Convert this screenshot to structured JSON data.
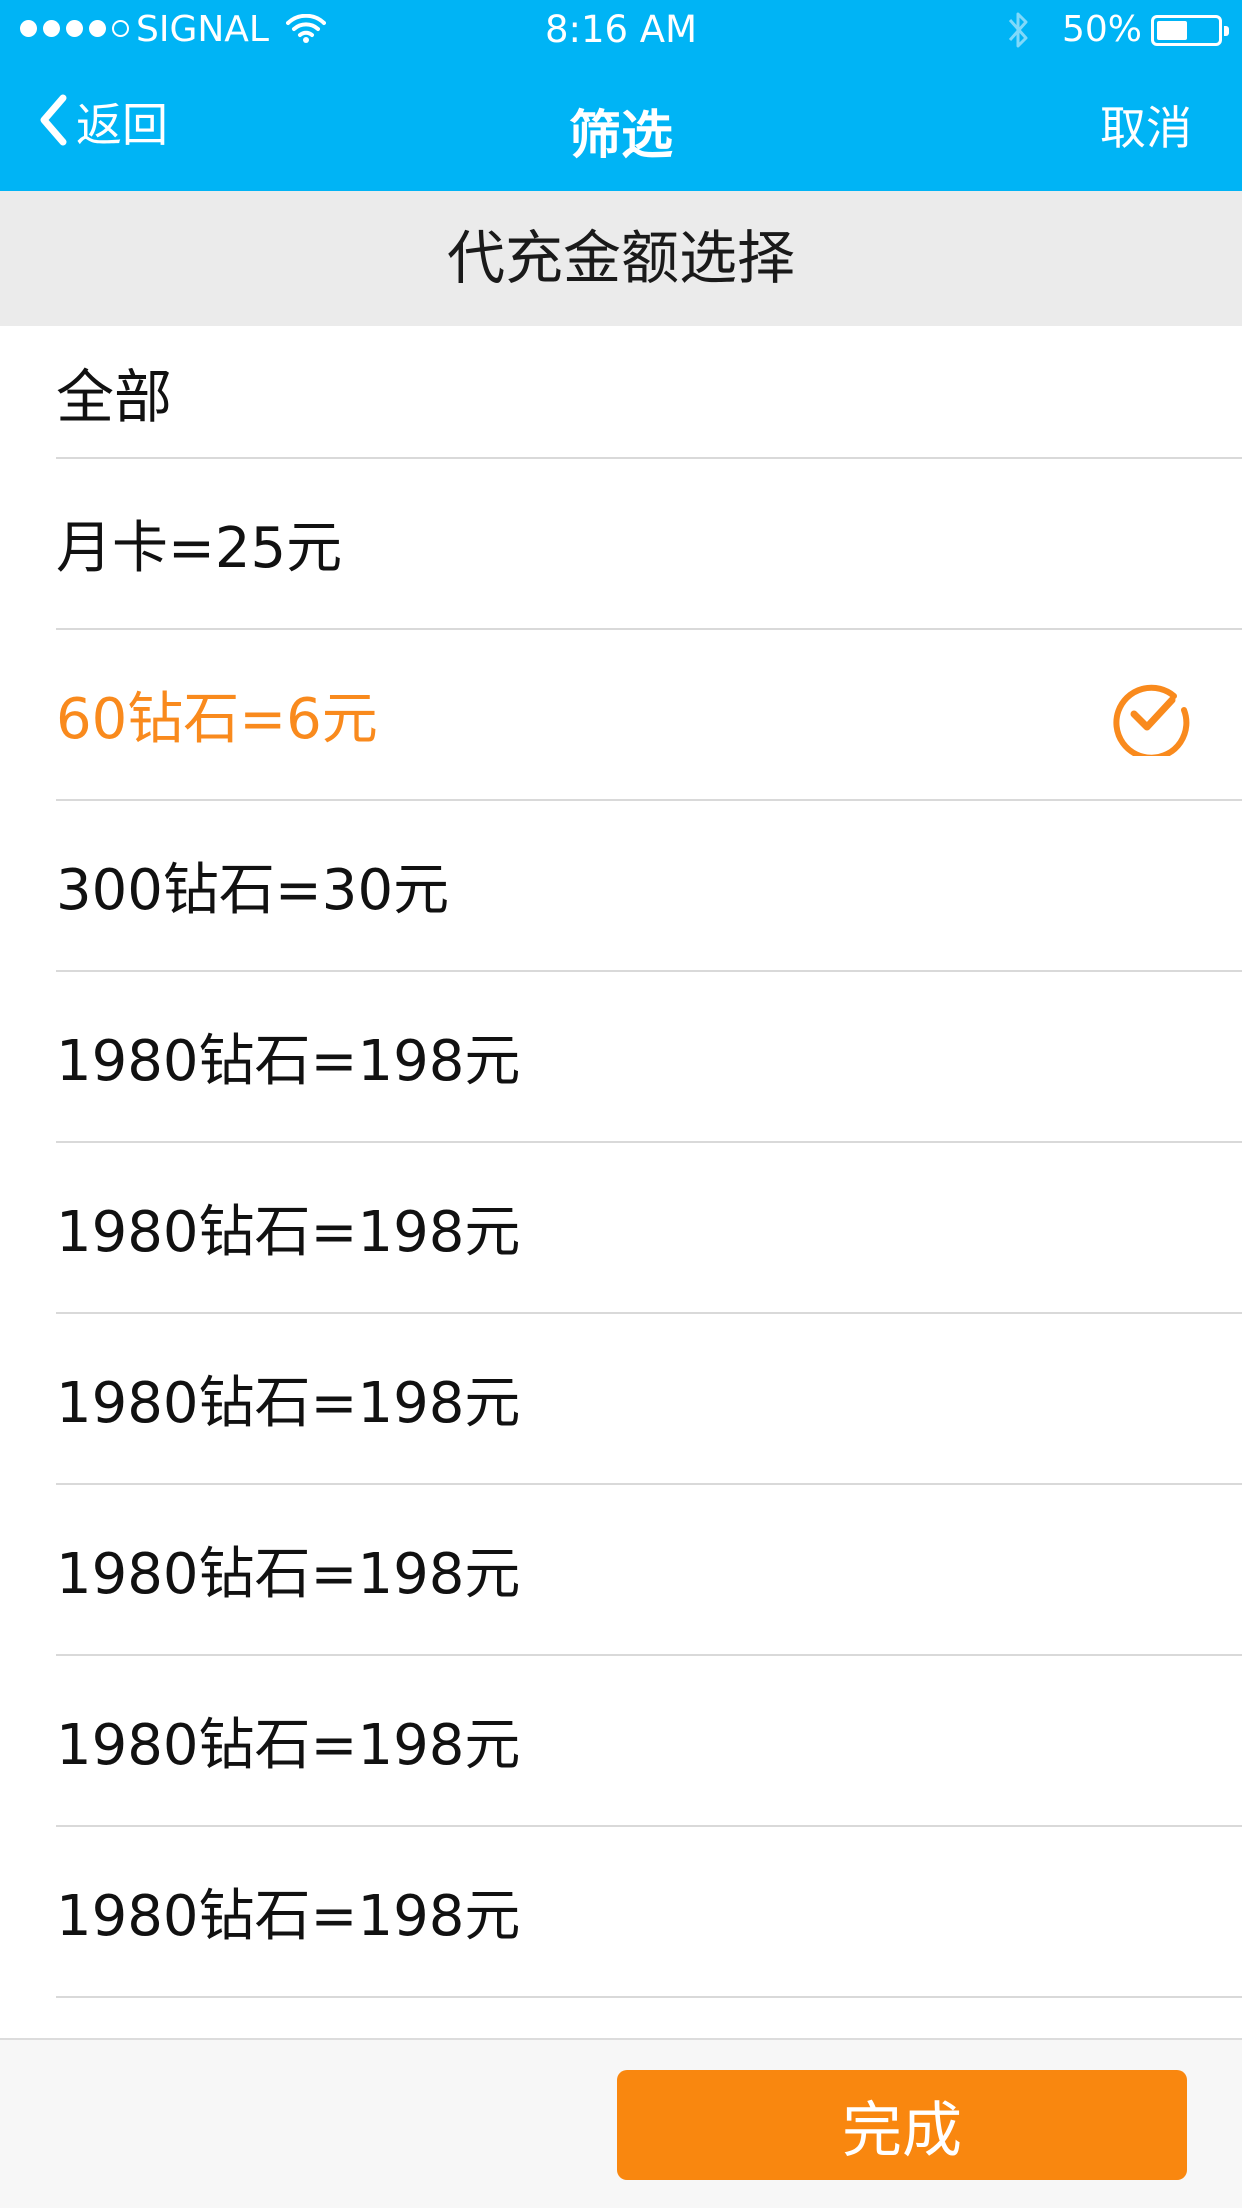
{
  "status_bar": {
    "carrier": "SIGNAL",
    "time": "8:16 AM",
    "battery": "50%",
    "battery_level": 0.5,
    "signal_bars_filled": 4
  },
  "nav": {
    "back_label": "返回",
    "title": "筛选",
    "cancel_label": "取消"
  },
  "section": {
    "title": "代充金额选择"
  },
  "options": [
    {
      "label": "全部",
      "selected": false
    },
    {
      "label": "月卡=25元",
      "selected": false
    },
    {
      "label": "60钻石=6元",
      "selected": true
    },
    {
      "label": "300钻石=30元",
      "selected": false
    },
    {
      "label": "1980钻石=198元",
      "selected": false
    },
    {
      "label": "1980钻石=198元",
      "selected": false
    },
    {
      "label": "1980钻石=198元",
      "selected": false
    },
    {
      "label": "1980钻石=198元",
      "selected": false
    },
    {
      "label": "1980钻石=198元",
      "selected": false
    },
    {
      "label": "1980钻石=198元",
      "selected": false
    }
  ],
  "footer": {
    "done_label": "完成"
  },
  "colors": {
    "header_blue": "#00b4f5",
    "accent_orange": "#f98a1d",
    "button_orange": "#f9870f"
  },
  "icons": {
    "back": "chevron-left-icon",
    "selected": "check-circle-icon",
    "wifi": "wifi-icon",
    "bluetooth": "bluetooth-icon",
    "battery": "battery-icon"
  }
}
